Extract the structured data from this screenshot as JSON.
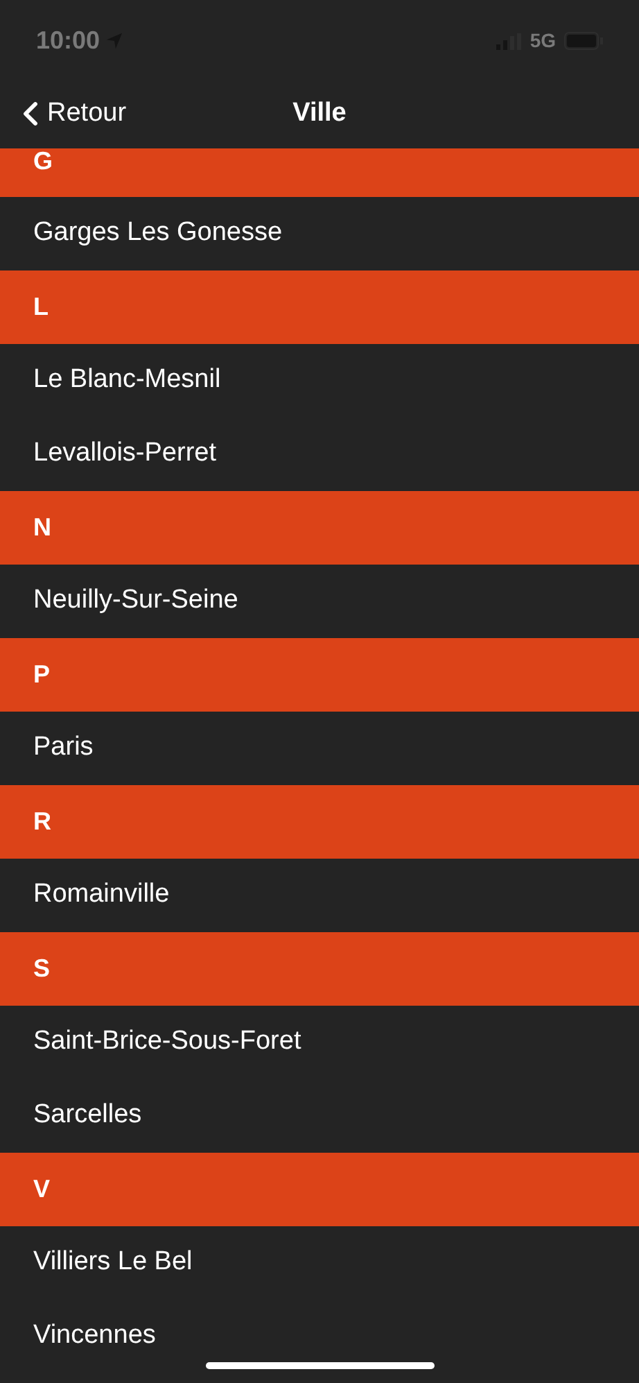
{
  "status_bar": {
    "time": "10:00",
    "network": "5G"
  },
  "nav": {
    "back": "Retour",
    "title": "Ville"
  },
  "list": [
    {
      "kind": "header",
      "label": "G"
    },
    {
      "kind": "item",
      "label": "Garges Les Gonesse"
    },
    {
      "kind": "header",
      "label": "L"
    },
    {
      "kind": "item",
      "label": "Le Blanc-Mesnil"
    },
    {
      "kind": "item",
      "label": "Levallois-Perret"
    },
    {
      "kind": "header",
      "label": "N"
    },
    {
      "kind": "item",
      "label": "Neuilly-Sur-Seine"
    },
    {
      "kind": "header",
      "label": "P"
    },
    {
      "kind": "item",
      "label": "Paris"
    },
    {
      "kind": "header",
      "label": "R"
    },
    {
      "kind": "item",
      "label": "Romainville"
    },
    {
      "kind": "header",
      "label": "S"
    },
    {
      "kind": "item",
      "label": "Saint-Brice-Sous-Foret"
    },
    {
      "kind": "item",
      "label": "Sarcelles"
    },
    {
      "kind": "header",
      "label": "V"
    },
    {
      "kind": "item",
      "label": "Villiers Le Bel"
    },
    {
      "kind": "item",
      "label": "Vincennes"
    }
  ]
}
